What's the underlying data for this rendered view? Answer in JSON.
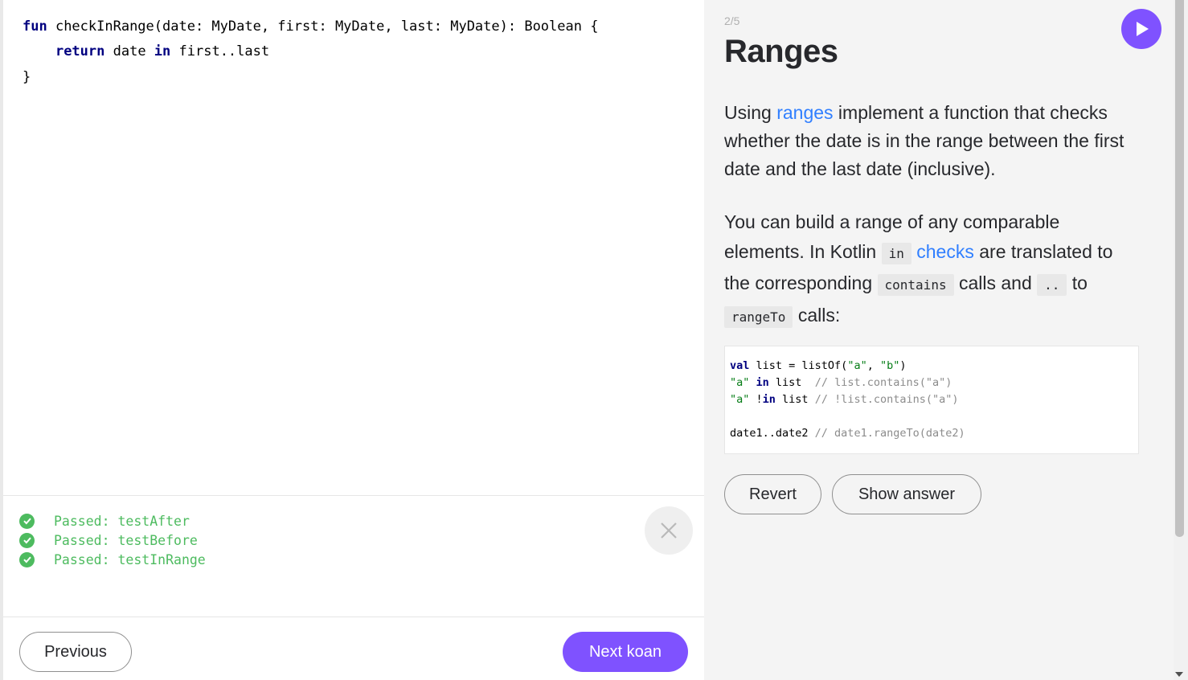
{
  "editor": {
    "lines": [
      [
        {
          "t": "fun",
          "c": "kw"
        },
        {
          "t": " checkInRange(date: MyDate, first: MyDate, last: MyDate): Boolean {",
          "c": ""
        }
      ],
      [
        {
          "t": "    ",
          "c": ""
        },
        {
          "t": "return",
          "c": "kw"
        },
        {
          "t": " date ",
          "c": ""
        },
        {
          "t": "in",
          "c": "kw"
        },
        {
          "t": " first..last",
          "c": ""
        }
      ],
      [
        {
          "t": "}",
          "c": ""
        }
      ]
    ]
  },
  "results": [
    {
      "label": "Passed: testAfter"
    },
    {
      "label": "Passed: testBefore"
    },
    {
      "label": "Passed: testInRange"
    }
  ],
  "footer": {
    "previous_label": "Previous",
    "next_label": "Next koan"
  },
  "task": {
    "step": "2/5",
    "title": "Ranges",
    "p1": {
      "before": "Using ",
      "link": "ranges",
      "after": " implement a function that checks whether the date is in the range between the first date and the last date (inclusive)."
    },
    "p2": {
      "t1": "You can build a range of any comparable elements. In Kotlin ",
      "code1": "in",
      "t2": " ",
      "link": "checks",
      "t3": " are translated to the corresponding ",
      "code2": "contains",
      "t4": " calls and ",
      "code3": "..",
      "t5": " to ",
      "code4": "rangeTo",
      "t6": " calls:"
    },
    "code_block": [
      [
        {
          "t": "val",
          "c": "kw"
        },
        {
          "t": " list = listOf(",
          "c": ""
        },
        {
          "t": "\"a\"",
          "c": "str"
        },
        {
          "t": ", ",
          "c": ""
        },
        {
          "t": "\"b\"",
          "c": "str"
        },
        {
          "t": ")",
          "c": ""
        }
      ],
      [
        {
          "t": "\"a\"",
          "c": "str"
        },
        {
          "t": " ",
          "c": ""
        },
        {
          "t": "in",
          "c": "kw"
        },
        {
          "t": " list  ",
          "c": ""
        },
        {
          "t": "// list.contains(\"a\")",
          "c": "cmt"
        }
      ],
      [
        {
          "t": "\"a\"",
          "c": "str"
        },
        {
          "t": " !",
          "c": ""
        },
        {
          "t": "in",
          "c": "kw"
        },
        {
          "t": " list ",
          "c": ""
        },
        {
          "t": "// !list.contains(\"a\")",
          "c": "cmt"
        }
      ],
      [],
      [
        {
          "t": "date1..date2 ",
          "c": ""
        },
        {
          "t": "// date1.rangeTo(date2)",
          "c": "cmt"
        }
      ]
    ],
    "revert_label": "Revert",
    "show_answer_label": "Show answer"
  },
  "colors": {
    "accent": "#7f52ff",
    "pass_green": "#4dbb5f",
    "link_blue": "#307fff"
  },
  "icons": [
    "check-circle-icon",
    "close-icon",
    "play-icon"
  ]
}
